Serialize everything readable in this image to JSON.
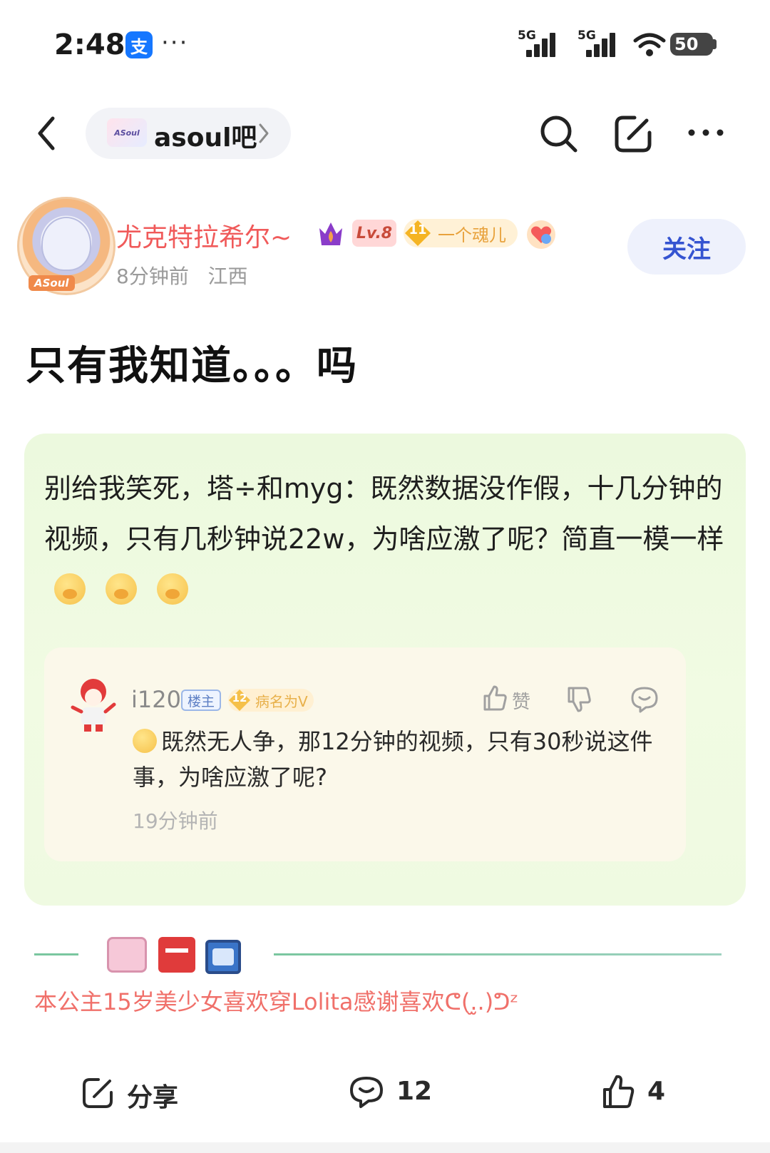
{
  "status_bar": {
    "time": "2:48",
    "app_icon_glyph": "支",
    "overflow": "···",
    "signal_1_label": "5G",
    "signal_2_label": "5G",
    "battery": "50"
  },
  "nav": {
    "forum_name": "asoul吧",
    "forum_logo_text": "ASoul",
    "icons": [
      "back-icon",
      "search-icon",
      "edit-icon",
      "more-icon"
    ]
  },
  "author": {
    "name": "尤克特拉希尔~",
    "level": "Lv.8",
    "fan_level": "11",
    "fan_name": "一个魂儿",
    "avatar_tag": "ASoul",
    "time": "8分钟前",
    "location": "江西",
    "follow_label": "关注"
  },
  "post": {
    "title": "只有我知道。。。吗",
    "body": "别给我笑死，塔÷和myg：既然数据没作假，十几分钟的视频，只有几秒钟说22w，为啥应激了呢？简直一模一样"
  },
  "quoted_comment": {
    "user": "i120",
    "op_badge": "楼主",
    "fan_level": "12",
    "fan_name": "病名为V",
    "like_label": "赞",
    "text": "既然无人争，那12分钟的视频，只有30秒说这件事，为啥应激了呢?",
    "time": "19分钟前"
  },
  "signature": {
    "text": "本公主15岁美少女喜欢穿Lolita感谢喜欢ᕦ(.̫.)ᕤᶻ"
  },
  "actions": {
    "share_label": "分享",
    "comment_count": "12",
    "like_count": "4"
  },
  "colors": {
    "accent_blue": "#3554d1",
    "author_name": "#f05a5a",
    "card_green": "#ecf9de"
  }
}
